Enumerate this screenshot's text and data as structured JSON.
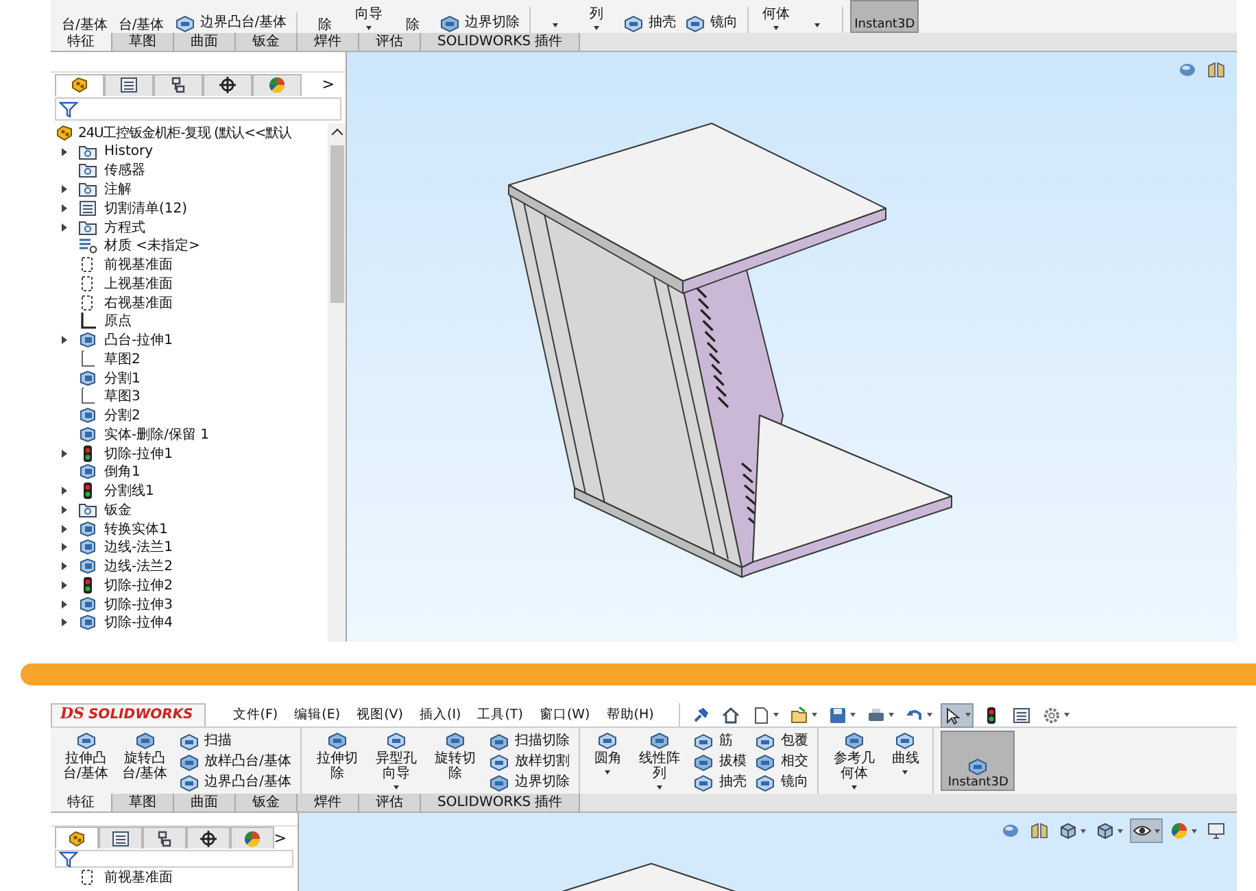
{
  "top_screenshot": {
    "toolbar": [
      {
        "items": [
          {
            "kind": "big",
            "text": "台/基体",
            "dropdown": false
          },
          {
            "kind": "big",
            "text": "台/基体",
            "dropdown": false
          },
          {
            "kind": "stack",
            "items": [
              "边界凸台/基体"
            ]
          }
        ]
      },
      {
        "items": [
          {
            "kind": "big",
            "text": "除",
            "dropdown": false
          },
          {
            "kind": "big",
            "text": "向导",
            "dropdown": true
          },
          {
            "kind": "big",
            "text": "除",
            "dropdown": false
          },
          {
            "kind": "stack",
            "items": [
              "边界切除"
            ]
          }
        ]
      },
      {
        "items": [
          {
            "kind": "arrow"
          },
          {
            "kind": "big",
            "text": "列",
            "dropdown": true
          },
          {
            "kind": "stack",
            "items": [
              "抽壳"
            ]
          },
          {
            "kind": "stack",
            "items": [
              "镜向"
            ]
          }
        ]
      },
      {
        "items": [
          {
            "kind": "big",
            "text": "何体",
            "dropdown": true
          },
          {
            "kind": "arrow"
          }
        ]
      },
      {
        "items": [
          {
            "kind": "toggle",
            "text": "Instant3D",
            "pressed": true
          }
        ]
      }
    ],
    "tabs": [
      {
        "label": "特征",
        "selected": true
      },
      {
        "label": "草图",
        "selected": false
      },
      {
        "label": "曲面",
        "selected": false
      },
      {
        "label": "钣金",
        "selected": false
      },
      {
        "label": "焊件",
        "selected": false
      },
      {
        "label": "评估",
        "selected": false
      },
      {
        "label": "SOLIDWORKS 插件",
        "selected": false
      }
    ],
    "feature_manager": {
      "panel_tabs": [
        {
          "selected": true
        },
        {
          "selected": false
        },
        {
          "selected": false
        },
        {
          "selected": false
        },
        {
          "selected": false
        }
      ],
      "more": ">",
      "root": {
        "text": "24U工控钣金机柜-复现 (默认<<默认"
      },
      "items": [
        {
          "text": "History",
          "kind": "folder",
          "expandable": true
        },
        {
          "text": "传感器",
          "kind": "folder",
          "expandable": false
        },
        {
          "text": "注解",
          "kind": "folder",
          "expandable": true
        },
        {
          "text": "切割清单(12)",
          "kind": "list",
          "expandable": true
        },
        {
          "text": "方程式",
          "kind": "folder",
          "expandable": true
        },
        {
          "text": "材质 <未指定>",
          "kind": "material",
          "expandable": false
        },
        {
          "text": "前视基准面",
          "kind": "plane",
          "expandable": false
        },
        {
          "text": "上视基准面",
          "kind": "plane",
          "expandable": false
        },
        {
          "text": "右视基准面",
          "kind": "plane",
          "expandable": false
        },
        {
          "text": "原点",
          "kind": "origin",
          "expandable": false
        },
        {
          "text": "凸台-拉伸1",
          "kind": "feature",
          "expandable": true
        },
        {
          "text": "草图2",
          "kind": "sketch",
          "expandable": false
        },
        {
          "text": "分割1",
          "kind": "feature",
          "expandable": false
        },
        {
          "text": "草图3",
          "kind": "sketch",
          "expandable": false
        },
        {
          "text": "分割2",
          "kind": "feature",
          "expandable": false
        },
        {
          "text": "实体-删除/保留 1",
          "kind": "feature",
          "expandable": false
        },
        {
          "text": "切除-拉伸1",
          "kind": "status",
          "expandable": true
        },
        {
          "text": "倒角1",
          "kind": "feature",
          "expandable": false
        },
        {
          "text": "分割线1",
          "kind": "status",
          "expandable": true
        },
        {
          "text": "钣金",
          "kind": "folder",
          "expandable": true
        },
        {
          "text": "转换实体1",
          "kind": "feature",
          "expandable": true
        },
        {
          "text": "边线-法兰1",
          "kind": "feature",
          "expandable": true
        },
        {
          "text": "边线-法兰2",
          "kind": "feature",
          "expandable": true
        },
        {
          "text": "切除-拉伸2",
          "kind": "status",
          "expandable": true
        },
        {
          "text": "切除-拉伸3",
          "kind": "feature",
          "expandable": true
        },
        {
          "text": "切除-拉伸4",
          "kind": "feature",
          "expandable": true
        }
      ]
    },
    "view_toolbar": [
      {
        "dropdown": false,
        "selected": false
      },
      {
        "dropdown": false,
        "selected": false
      }
    ]
  },
  "bottom_screenshot": {
    "logo": {
      "mark": "DS",
      "name": "SOLIDWORKS"
    },
    "menus": [
      "文件(F)",
      "编辑(E)",
      "视图(V)",
      "插入(I)",
      "工具(T)",
      "窗口(W)",
      "帮助(H)"
    ],
    "quick_access": [
      {
        "dropdown": false,
        "selected": false
      },
      {
        "dropdown": false,
        "selected": false
      },
      {
        "dropdown": true,
        "selected": false
      },
      {
        "dropdown": true,
        "selected": false
      },
      {
        "dropdown": true,
        "selected": false
      },
      {
        "dropdown": true,
        "selected": false
      },
      {
        "dropdown": true,
        "selected": false
      },
      {
        "dropdown": true,
        "selected": true
      },
      {
        "dropdown": false,
        "selected": false
      },
      {
        "dropdown": false,
        "selected": false
      },
      {
        "dropdown": true,
        "selected": false
      }
    ],
    "toolbar": [
      {
        "items": [
          {
            "kind": "big",
            "text": "拉伸凸台/基体",
            "dropdown": false
          },
          {
            "kind": "big",
            "text": "旋转凸台/基体",
            "dropdown": false
          },
          {
            "kind": "stack",
            "items": [
              "扫描",
              "放样凸台/基体",
              "边界凸台/基体"
            ]
          }
        ]
      },
      {
        "items": [
          {
            "kind": "big",
            "text": "拉伸切除",
            "dropdown": false
          },
          {
            "kind": "big",
            "text": "异型孔向导",
            "dropdown": true
          },
          {
            "kind": "big",
            "text": "旋转切除",
            "dropdown": false
          },
          {
            "kind": "stack",
            "items": [
              "扫描切除",
              "放样切割",
              "边界切除"
            ]
          }
        ]
      },
      {
        "items": [
          {
            "kind": "big",
            "text": "圆角",
            "dropdown": true
          },
          {
            "kind": "big",
            "text": "线性阵列",
            "dropdown": true
          },
          {
            "kind": "stack",
            "items": [
              "筋",
              "拔模",
              "抽壳"
            ]
          },
          {
            "kind": "stack",
            "items": [
              "包覆",
              "相交",
              "镜向"
            ]
          }
        ]
      },
      {
        "items": [
          {
            "kind": "big",
            "text": "参考几何体",
            "dropdown": true
          },
          {
            "kind": "big",
            "text": "曲线",
            "dropdown": true
          }
        ]
      },
      {
        "items": [
          {
            "kind": "toggle",
            "text": "Instant3D",
            "pressed": true
          }
        ]
      }
    ],
    "tabs": [
      {
        "label": "特征",
        "selected": true
      },
      {
        "label": "草图",
        "selected": false
      },
      {
        "label": "曲面",
        "selected": false
      },
      {
        "label": "钣金",
        "selected": false
      },
      {
        "label": "焊件",
        "selected": false
      },
      {
        "label": "评估",
        "selected": false
      },
      {
        "label": "SOLIDWORKS 插件",
        "selected": false
      }
    ],
    "feature_manager": {
      "panel_tabs": [
        {
          "selected": true
        },
        {
          "selected": false
        },
        {
          "selected": false
        },
        {
          "selected": false
        },
        {
          "selected": false
        }
      ],
      "more": ">",
      "items": [
        {
          "text": "前视基准面",
          "kind": "plane",
          "expandable": false
        }
      ]
    },
    "view_toolbar": [
      {
        "dropdown": false,
        "selected": false
      },
      {
        "dropdown": false,
        "selected": false
      },
      {
        "dropdown": true,
        "selected": false
      },
      {
        "dropdown": true,
        "selected": false
      },
      {
        "dropdown": true,
        "selected": true
      },
      {
        "dropdown": true,
        "selected": false
      },
      {
        "dropdown": false,
        "selected": false
      }
    ]
  }
}
